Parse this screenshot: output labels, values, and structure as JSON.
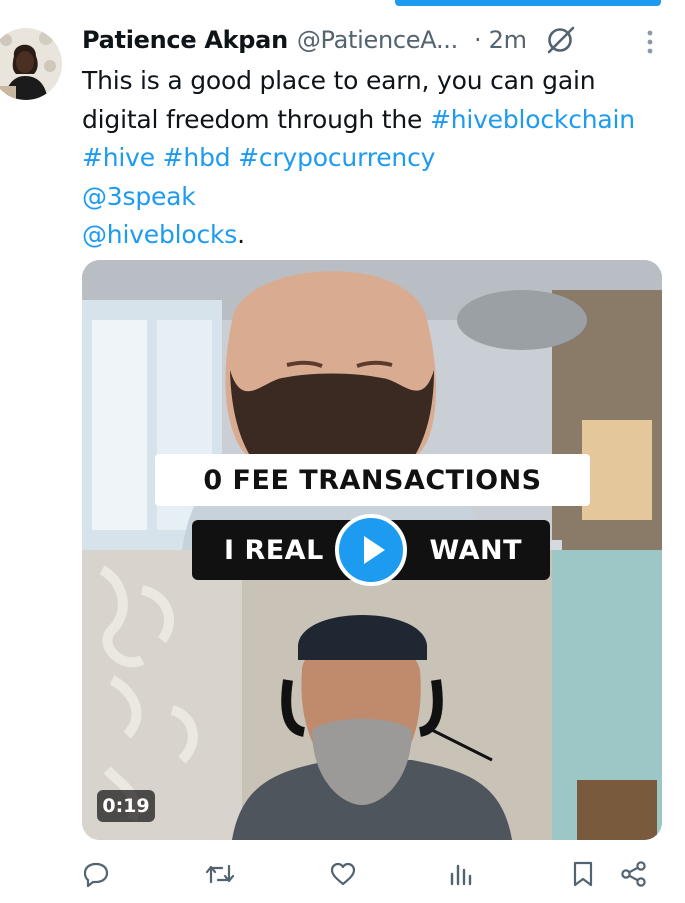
{
  "tweet": {
    "author_name": "Patience Akpan",
    "author_handle": "@PatienceA...",
    "time": "· 2m",
    "text_line1": "This is  a good place to earn, you can gain digital freedom through the ",
    "hashtag_hiveblockchain": "#hiveblockchain",
    "hashtag_hive": "#hive",
    "hashtag_hbd": "#hbd",
    "hashtag_crypocurrency": "#crypocurrency",
    "mention_3speak": "@3speak",
    "mention_hiveblocks": "@hiveblocks",
    "trailing_period": "."
  },
  "video": {
    "caption_line1": "0 FEE TRANSACTIONS",
    "caption_line2_left": "I REAL",
    "caption_line2_right": "WANT",
    "duration": "0:19"
  },
  "icons": {
    "reply": "reply-icon",
    "retweet": "retweet-icon",
    "like": "heart-icon",
    "views": "analytics-icon",
    "bookmark": "bookmark-icon",
    "share": "share-icon",
    "grok": "grok-icon",
    "more": "more-vertical-icon",
    "play": "play-icon"
  },
  "colors": {
    "accent": "#1d9bf0",
    "text": "#0f1419",
    "secondary": "#536471"
  }
}
